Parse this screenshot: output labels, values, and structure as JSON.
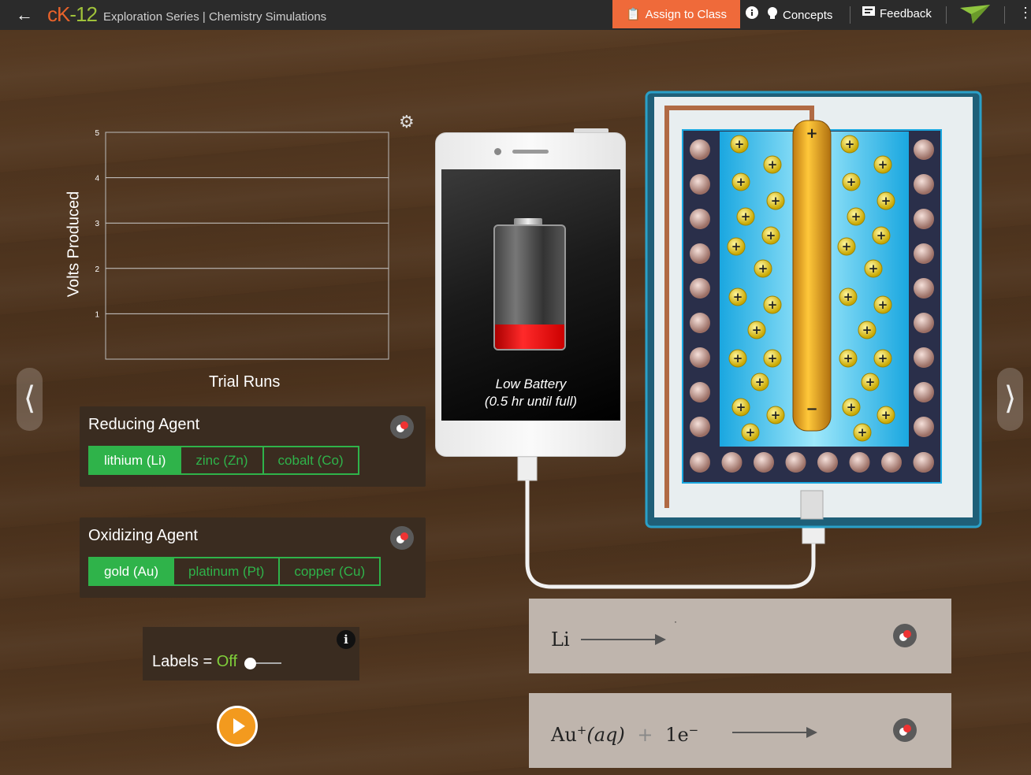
{
  "header": {
    "back_icon": "arrow-left-icon",
    "logo_ck": "cK",
    "logo_12": "-12",
    "subtitle": "Exploration Series | Chemistry Simulations",
    "assign_label": "Assign to Class",
    "concepts_label": "Concepts",
    "feedback_label": "Feedback"
  },
  "chart_data": {
    "type": "bar",
    "title": "",
    "xlabel": "Trial Runs",
    "ylabel": "Volts Produced",
    "yticks": [
      "1",
      "2",
      "3",
      "4",
      "5"
    ],
    "ylim": [
      0,
      5
    ],
    "grid": true,
    "series": []
  },
  "reducing": {
    "title": "Reducing Agent",
    "options": [
      "lithium (Li)",
      "zinc (Zn)",
      "cobalt (Co)"
    ],
    "selected": "lithium (Li)"
  },
  "oxidizing": {
    "title": "Oxidizing Agent",
    "options": [
      "gold (Au)",
      "platinum (Pt)",
      "copper (Cu)"
    ],
    "selected": "gold (Au)"
  },
  "labels_toggle": {
    "label": "Labels =",
    "state": "Off",
    "info_symbol": "i"
  },
  "phone": {
    "battery_line1": "Low Battery",
    "battery_line2": "(0.5 hr until full)",
    "battery_level": 0.2
  },
  "cell": {
    "anode_plus": "+",
    "anode_minus": "−"
  },
  "equations": {
    "eq1_reactant": "Li",
    "eq1_dot": "·",
    "eq2_ion": "Au",
    "eq2_charge": "+",
    "eq2_state": "(aq)",
    "eq2_plus": "+",
    "eq2_electron": "1e",
    "eq2_e_charge": "−"
  },
  "colors": {
    "accent_green": "#2fb34a",
    "assign_orange": "#ef6a3a",
    "play_orange": "#f39a1e",
    "solution_blue": "#38c8f0"
  }
}
